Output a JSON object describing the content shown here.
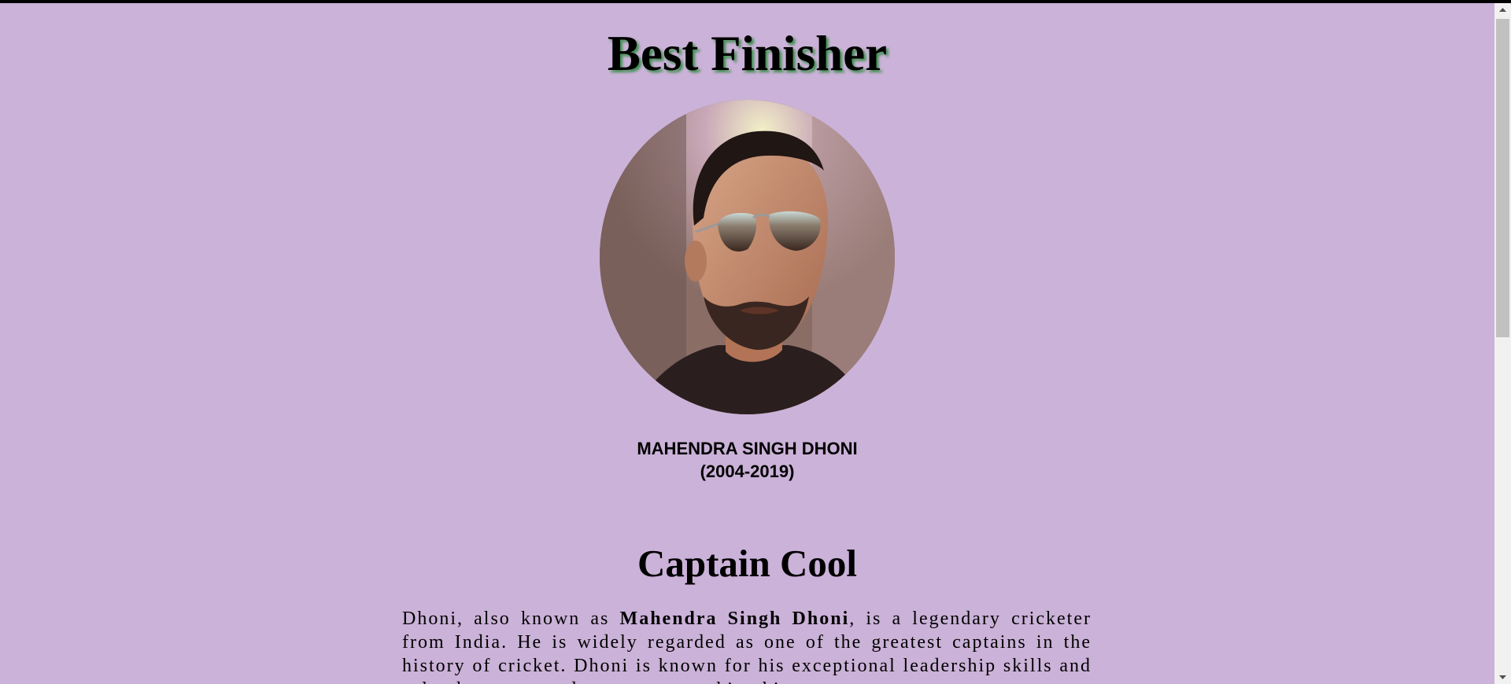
{
  "header": {
    "title": "Best Finisher"
  },
  "profile": {
    "photo_icon": "portrait-photo",
    "name": "MAHENDRA SINGH DHONI",
    "years": "(2004-2019)"
  },
  "section": {
    "title": "Captain Cool",
    "bio_pre": "Dhoni, also known as ",
    "bio_bold": "Mahendra Singh Dhoni",
    "bio_post": ", is a legendary cricketer from India. He is widely regarded as one of the greatest captains in the history of cricket. Dhoni is known for his exceptional leadership skills and calm demeanor under pressure, making him"
  },
  "colors": {
    "background": "#cbb2d8",
    "title_shadow": "#3f8f4f",
    "text": "#000000"
  }
}
